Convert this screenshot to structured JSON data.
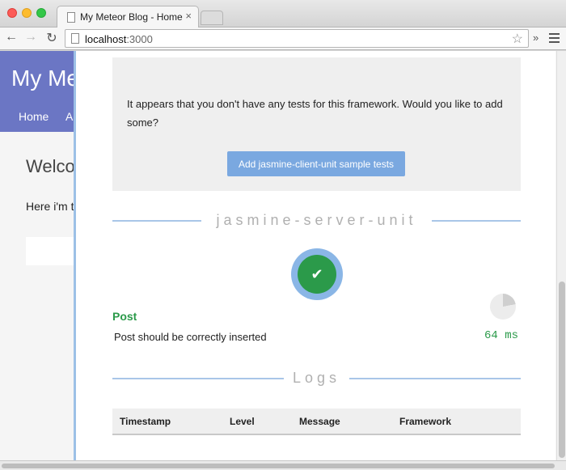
{
  "browser": {
    "tab_title": "My Meteor Blog - Home",
    "tab_close": "×",
    "url_host": "localhost",
    "url_port": ":3000",
    "icons": {
      "back": "arrow-left-icon",
      "forward": "arrow-right-icon",
      "reload": "reload-icon",
      "star": "star-icon",
      "more": "chevron-double-right-icon",
      "menu": "hamburger-menu-icon"
    }
  },
  "blog": {
    "title": "My Me",
    "nav_home": "Home",
    "nav_a": "A",
    "welcome": "Welco",
    "text": "Here i'm t",
    "header_color": "#6b76c4"
  },
  "velocity": {
    "notice_text": "It appears that you don't have any tests for this framework. Would you like to add some?",
    "add_button": "Add jasmine-client-unit sample tests",
    "server_section": "jasmine-server-unit",
    "status_check": "✔",
    "suite_name": "Post",
    "test_name": "Post should be correctly inserted",
    "test_time": "64 ms",
    "logs_section": "Logs",
    "logs_columns": [
      "Timestamp",
      "Level",
      "Message",
      "Framework"
    ],
    "colors": {
      "pass": "#2b9a4a",
      "accent": "#8ab6e6",
      "button": "#7aa8e0"
    }
  }
}
